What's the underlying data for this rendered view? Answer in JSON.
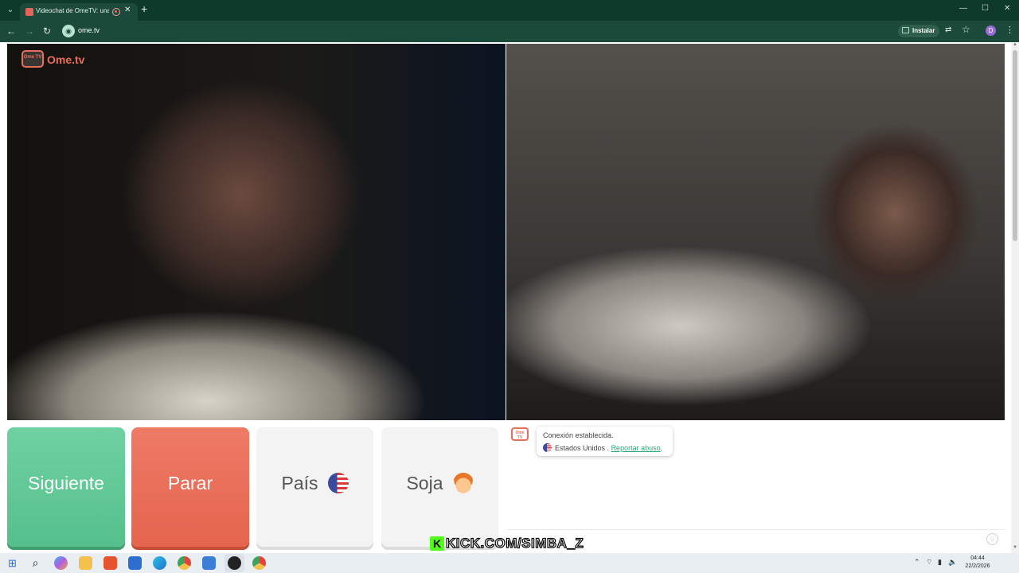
{
  "browser": {
    "tab": {
      "title": "Videochat de OmeTV: una",
      "close_glyph": "✕"
    },
    "tab_menu_glyph": "⌄",
    "new_tab_glyph": "+",
    "window_controls": {
      "minimize": "—",
      "maximize": "☐",
      "close": "✕"
    },
    "nav": {
      "back": "←",
      "forward": "→",
      "reload": "↻"
    },
    "url": "ome.tv",
    "install_label": "Instalar",
    "translate_glyph": "⇄",
    "bookmark_glyph": "☆",
    "profile_initial": "D",
    "menu_glyph": "⋮"
  },
  "logo": {
    "badge": "Ome TV",
    "text": "Ome.tv"
  },
  "buttons": {
    "next": "Siguiente",
    "stop": "Parar",
    "country": "País",
    "gender": "Soja"
  },
  "chat": {
    "logo": "Ome TV",
    "status": "Conexión establecida.",
    "country": "Estados Unidos",
    "separator": " . ",
    "report": "Reportar abuso",
    "report_suffix": ".",
    "emoji_glyph": "☺"
  },
  "watermark": {
    "k": "K",
    "text": "KICK.COM/SIMBA_Z"
  },
  "taskbar": {
    "start": "⊞",
    "search": "⌕",
    "apps": [
      "copilot",
      "file-explorer",
      "brave",
      "store",
      "edge",
      "chrome",
      "vpn",
      "obs",
      "chrome-profile"
    ],
    "tray": {
      "chevron": "⌃",
      "wifi": "⌔",
      "battery": "▮",
      "volume": "🔈"
    },
    "time": "04:44",
    "date": "22/2/2026"
  },
  "colors": {
    "brand": "#e86e5c",
    "next_button": "#5ec795",
    "stop_button": "#e86e54",
    "link": "#2ea57a",
    "browser_frame": "#1b4a3a",
    "kick_green": "#53fc18"
  }
}
